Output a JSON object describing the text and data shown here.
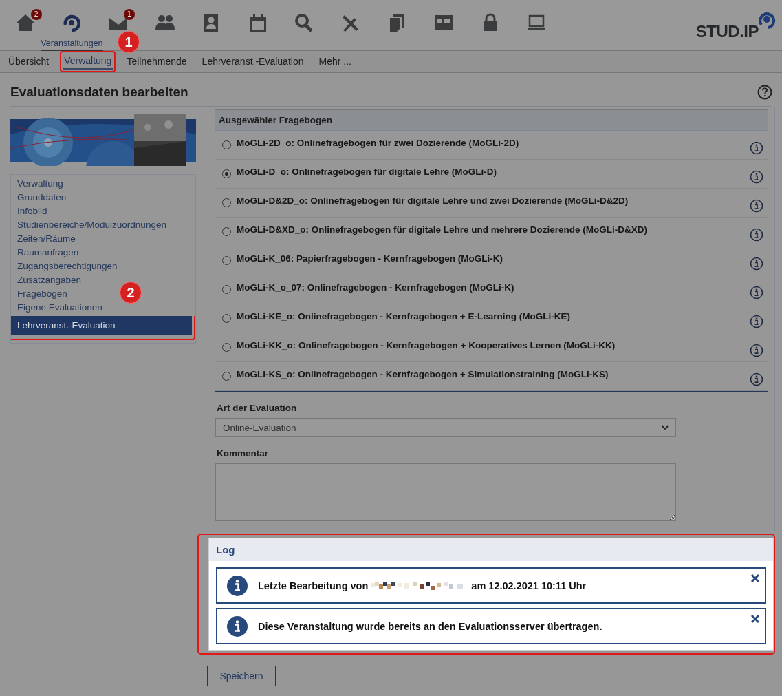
{
  "nav": {
    "items": [
      {
        "badge": "2",
        "selected": false
      },
      {
        "label": "Veranstaltungen",
        "selected": true
      },
      {
        "badge": "1",
        "selected": false
      },
      {
        "selected": false
      },
      {
        "selected": false
      },
      {
        "selected": false
      },
      {
        "selected": false
      },
      {
        "selected": false
      },
      {
        "selected": false
      },
      {
        "selected": false
      },
      {
        "selected": false
      },
      {
        "selected": false
      }
    ],
    "logo": "STUD.IP"
  },
  "tabs": [
    {
      "label": "Übersicht",
      "selected": false
    },
    {
      "label": "Verwaltung",
      "selected": true
    },
    {
      "label": "Teilnehmende",
      "selected": false
    },
    {
      "label": "Lehrveranst.-Evaluation",
      "selected": false
    },
    {
      "label": "Mehr ...",
      "selected": false
    }
  ],
  "page_title": "Evaluationsdaten bearbeiten",
  "sidebar": {
    "items": [
      {
        "label": "Verwaltung",
        "selected": false
      },
      {
        "label": "Grunddaten",
        "selected": false
      },
      {
        "label": "Infobild",
        "selected": false
      },
      {
        "label": "Studienbereiche/Modulzuordnungen",
        "selected": false
      },
      {
        "label": "Zeiten/Räume",
        "selected": false
      },
      {
        "label": "Raumanfragen",
        "selected": false
      },
      {
        "label": "Zugangsberechtigungen",
        "selected": false
      },
      {
        "label": "Zusatzangaben",
        "selected": false
      },
      {
        "label": "Fragebögen",
        "selected": false
      },
      {
        "label": "Eigene Evaluationen",
        "selected": false
      },
      {
        "label": "Lehrveranst.-Evaluation",
        "selected": true
      }
    ]
  },
  "questionnaire": {
    "header": "Ausgewähler Fragebogen",
    "options": [
      {
        "label": "MoGLi-2D_o: Onlinefragebogen für zwei Dozierende (MoGLi-2D)",
        "selected": false
      },
      {
        "label": "MoGLi-D_o: Onlinefragebogen für digitale Lehre (MoGLi-D)",
        "selected": true
      },
      {
        "label": "MoGLi-D&2D_o: Onlinefragebogen für digitale Lehre und zwei Dozierende (MoGLi-D&2D)",
        "selected": false
      },
      {
        "label": "MoGLi-D&XD_o: Onlinefragebogen für digitale Lehre und mehrere Dozierende (MoGLi-D&XD)",
        "selected": false
      },
      {
        "label": "MoGLi-K_06: Papierfragebogen - Kernfragebogen (MoGLi-K)",
        "selected": false
      },
      {
        "label": "MoGLi-K_o_07: Onlinefragebogen - Kernfragebogen (MoGLi-K)",
        "selected": false
      },
      {
        "label": "MoGLi-KE_o: Onlinefragebogen - Kernfragebogen + E-Learning (MoGLi-KE)",
        "selected": false
      },
      {
        "label": "MoGLi-KK_o: Onlinefragebogen - Kernfragebogen + Kooperatives Lernen (MoGLi-KK)",
        "selected": false
      },
      {
        "label": "MoGLi-KS_o: Onlinefragebogen - Kernfragebogen + Simulationstraining (MoGLi-KS)",
        "selected": false
      }
    ]
  },
  "evaluation_type": {
    "label": "Art der Evaluation",
    "value": "Online-Evaluation"
  },
  "comment": {
    "label": "Kommentar"
  },
  "log": {
    "title": "Log",
    "messages": [
      {
        "kind": "redacted",
        "text_before": "Letzte Bearbeitung von",
        "text_after": "am 12.02.2021 10:11 Uhr"
      },
      {
        "kind": "plain",
        "text": "Diese Veranstaltung wurde bereits an den Evaluationsserver übertragen."
      }
    ]
  },
  "save_button": "Speichern",
  "callouts": [
    {
      "number": "1"
    },
    {
      "number": "2"
    }
  ]
}
